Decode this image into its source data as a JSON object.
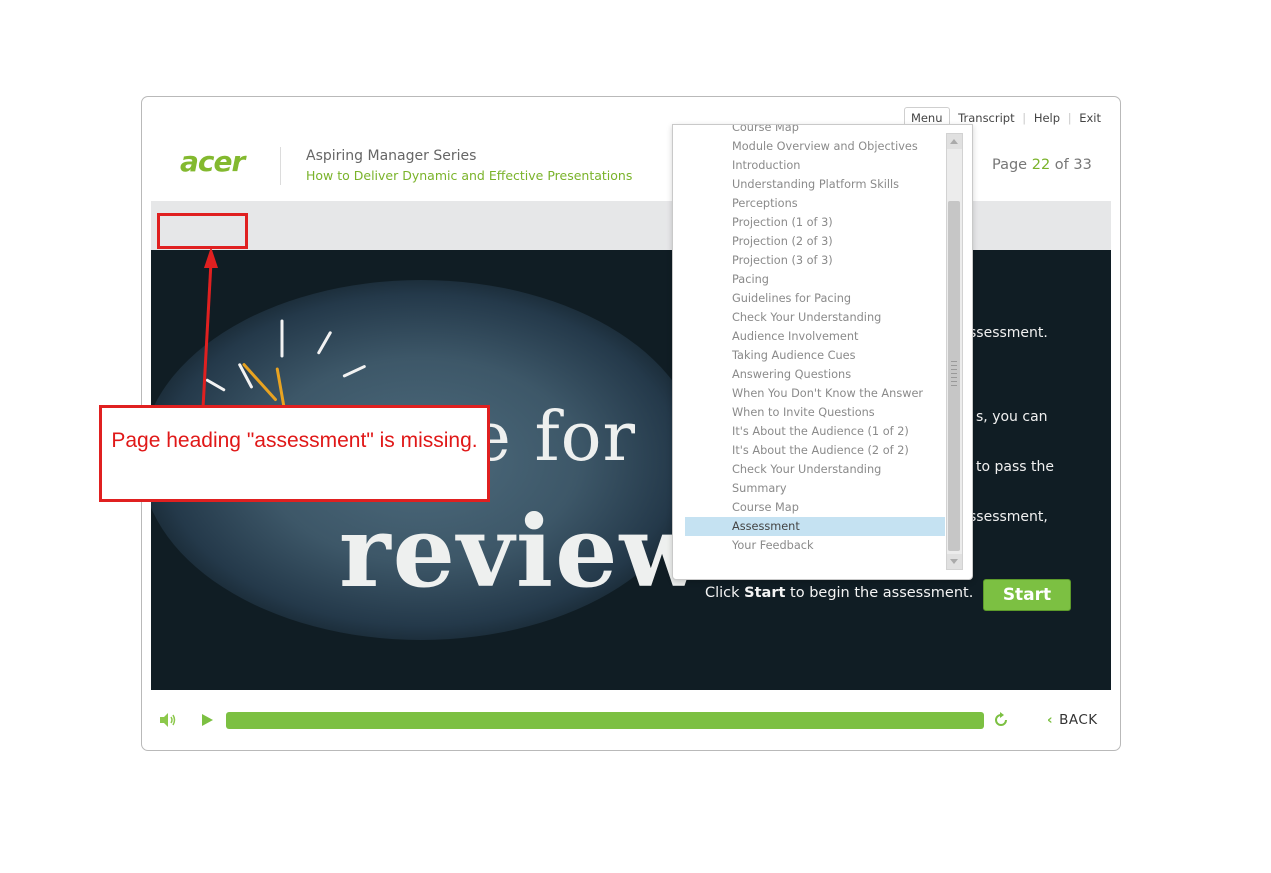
{
  "top_nav": {
    "menu": "Menu",
    "transcript": "Transcript",
    "help": "Help",
    "exit": "Exit",
    "separator": "|"
  },
  "brand": {
    "logo": "acer"
  },
  "header": {
    "series": "Aspiring Manager Series",
    "course": "How to Deliver Dynamic and Effective Presentations"
  },
  "page_counter": {
    "prefix": "Page",
    "current": "22",
    "of": "of",
    "total": "33"
  },
  "stage": {
    "chalk_line1": "Time for",
    "chalk_line2": "review",
    "text_fragments": [
      "ssessment.",
      "s, you can",
      "to pass the",
      "ssessment,"
    ],
    "start_prompt_before": "Click ",
    "start_prompt_bold": "Start",
    "start_prompt_after": " to begin the assessment.",
    "start_button": "Start"
  },
  "menu": {
    "items": [
      "Course Map",
      "Module Overview and Objectives",
      "Introduction",
      "Understanding Platform Skills",
      "Perceptions",
      "Projection (1 of 3)",
      "Projection (2 of 3)",
      "Projection (3 of 3)",
      "Pacing",
      "Guidelines for Pacing",
      "Check Your Understanding",
      "Audience Involvement",
      "Taking Audience Cues",
      "Answering Questions",
      "When You Don't Know the Answer",
      "When to Invite Questions",
      "It's About the Audience (1 of 2)",
      "It's About the Audience (2 of 2)",
      "Check Your Understanding",
      "Summary",
      "Course Map",
      "Assessment",
      "Your Feedback"
    ],
    "active_item": "Assessment"
  },
  "footer": {
    "progress_percent": 100,
    "back": "BACK",
    "accent_color": "#7cc042"
  },
  "annotation": {
    "callout_text": "Page heading \"assessment\" is missing.",
    "color": "#e02020"
  }
}
